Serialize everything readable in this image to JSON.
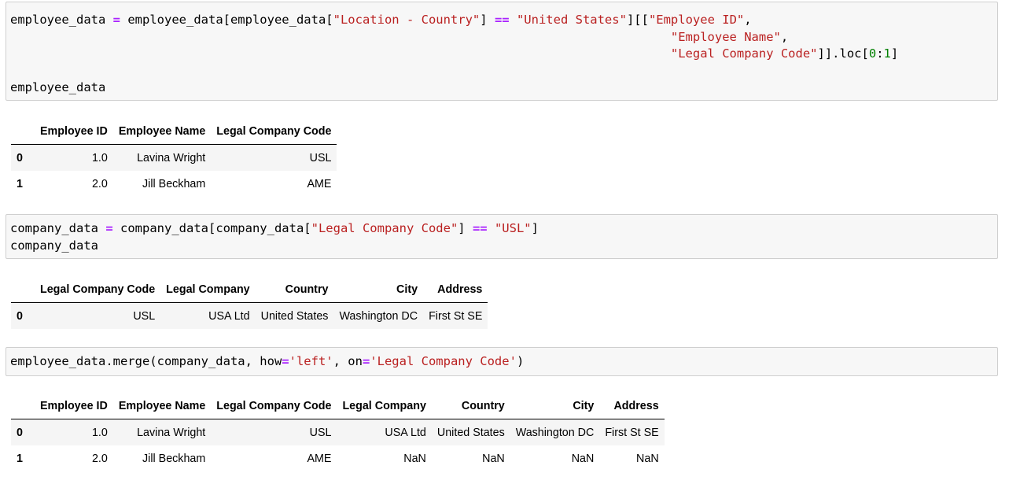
{
  "cell1": {
    "line1": {
      "a": "employee_data ",
      "op1": "=",
      "b": " employee_data[employee_data[",
      "s1": "\"Location - Country\"",
      "c": "] ",
      "op2": "==",
      "d": " ",
      "s2": "\"United States\"",
      "e": "][[",
      "s3": "\"Employee ID\"",
      "f": ","
    },
    "line2": {
      "s": "\"Employee Name\"",
      "f": ","
    },
    "line3": {
      "s": "\"Legal Company Code\"",
      "a": "]].loc[",
      "n1": "0",
      "colon": ":",
      "n2": "1",
      "b": "]"
    },
    "line5": "employee_data"
  },
  "table1": {
    "headers": [
      "",
      "Employee ID",
      "Employee Name",
      "Legal Company Code"
    ],
    "rows": [
      {
        "index": "0",
        "cells": [
          "1.0",
          "Lavina Wright",
          "USL"
        ]
      },
      {
        "index": "1",
        "cells": [
          "2.0",
          "Jill Beckham",
          "AME"
        ]
      }
    ]
  },
  "cell2": {
    "line1": {
      "a": "company_data ",
      "op1": "=",
      "b": " company_data[company_data[",
      "s1": "\"Legal Company Code\"",
      "c": "] ",
      "op2": "==",
      "d": " ",
      "s2": "\"USL\"",
      "e": "]"
    },
    "line2": "company_data"
  },
  "table2": {
    "headers": [
      "",
      "Legal Company Code",
      "Legal Company",
      "Country",
      "City",
      "Address"
    ],
    "rows": [
      {
        "index": "0",
        "cells": [
          "USL",
          "USA Ltd",
          "United States",
          "Washington DC",
          "First St SE"
        ]
      }
    ]
  },
  "cell3": {
    "a": "employee_data.merge(company_data, how",
    "op1": "=",
    "s1": "'left'",
    "b": ", on",
    "op2": "=",
    "s2": "'Legal Company Code'",
    "c": ")"
  },
  "table3": {
    "headers": [
      "",
      "Employee ID",
      "Employee Name",
      "Legal Company Code",
      "Legal Company",
      "Country",
      "City",
      "Address"
    ],
    "rows": [
      {
        "index": "0",
        "cells": [
          "1.0",
          "Lavina Wright",
          "USL",
          "USA Ltd",
          "United States",
          "Washington DC",
          "First St SE"
        ]
      },
      {
        "index": "1",
        "cells": [
          "2.0",
          "Jill Beckham",
          "AME",
          "NaN",
          "NaN",
          "NaN",
          "NaN"
        ]
      }
    ]
  },
  "colors": {
    "operator": "#aa22ff",
    "string": "#ba2121",
    "number": "#008000",
    "cell_bg": "#f7f7f7",
    "cell_border": "#cfcfcf"
  }
}
